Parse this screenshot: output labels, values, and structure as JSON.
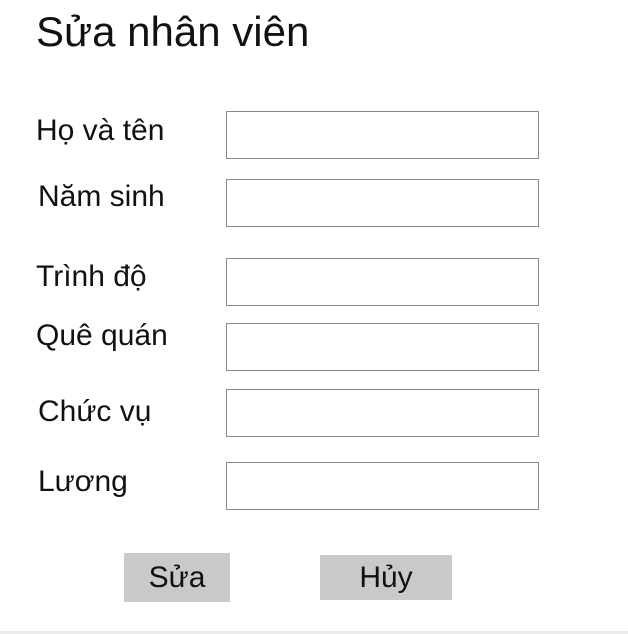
{
  "form": {
    "title": "Sửa nhân viên",
    "fields": [
      {
        "label": "Họ và tên",
        "value": ""
      },
      {
        "label": "Năm sinh",
        "value": ""
      },
      {
        "label": "Trình độ",
        "value": ""
      },
      {
        "label": "Quê quán",
        "value": ""
      },
      {
        "label": "Chức vụ",
        "value": ""
      },
      {
        "label": "Lương",
        "value": ""
      }
    ],
    "buttons": {
      "submit_label": "Sửa",
      "cancel_label": "Hủy"
    }
  },
  "colors": {
    "button_background": "#c9c9c9",
    "field_border": "#8a8a8a",
    "text": "#111111"
  }
}
